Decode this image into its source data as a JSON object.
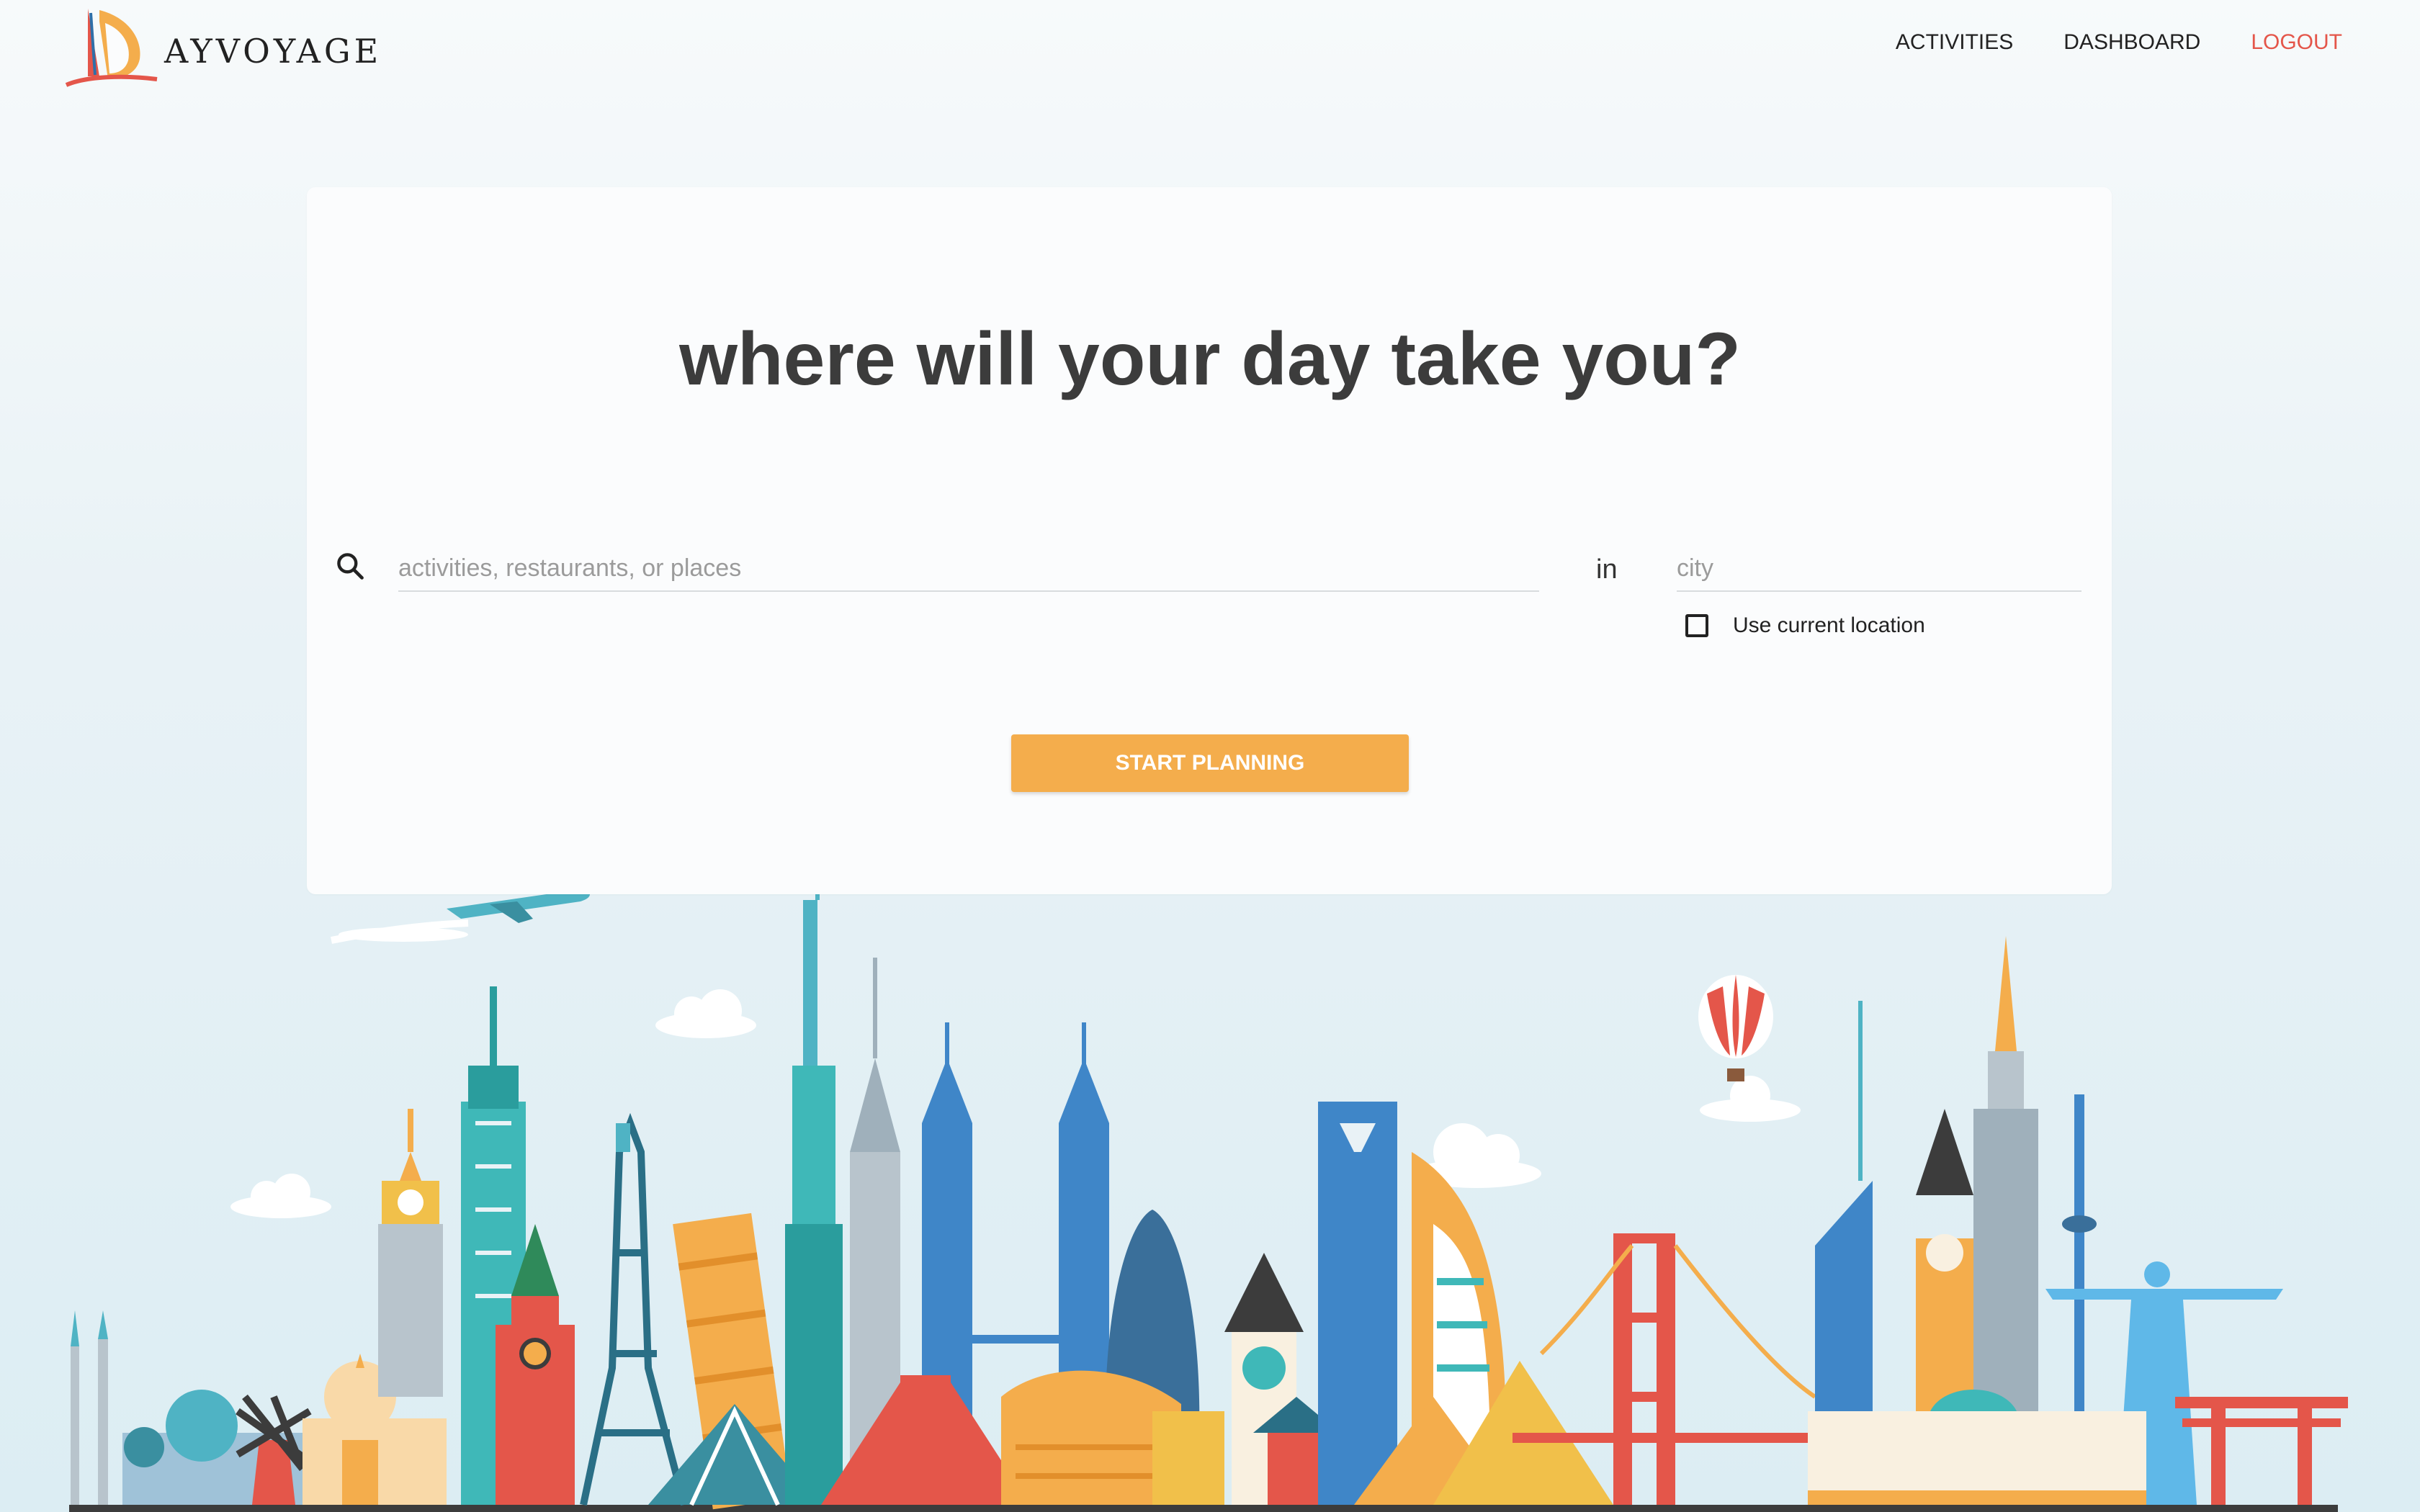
{
  "brand": {
    "logo_text": "AYVOYAGE",
    "logo_initial_icon": "sailboat-d-icon"
  },
  "nav": {
    "items": [
      "ACTIVITIES",
      "DASHBOARD"
    ],
    "logout": "LOGOUT"
  },
  "hero": {
    "headline": "where will your day take you?"
  },
  "search": {
    "query_value": "",
    "query_placeholder": "activities, restaurants, or places",
    "connector": "in",
    "city_value": "",
    "city_placeholder": "city",
    "use_location_label": "Use current location",
    "use_location_checked": false,
    "submit_label": "START PLANNING"
  },
  "colors": {
    "accent": "#f4ad4c",
    "logout": "#e4564a",
    "headline": "#3c3c3c"
  }
}
